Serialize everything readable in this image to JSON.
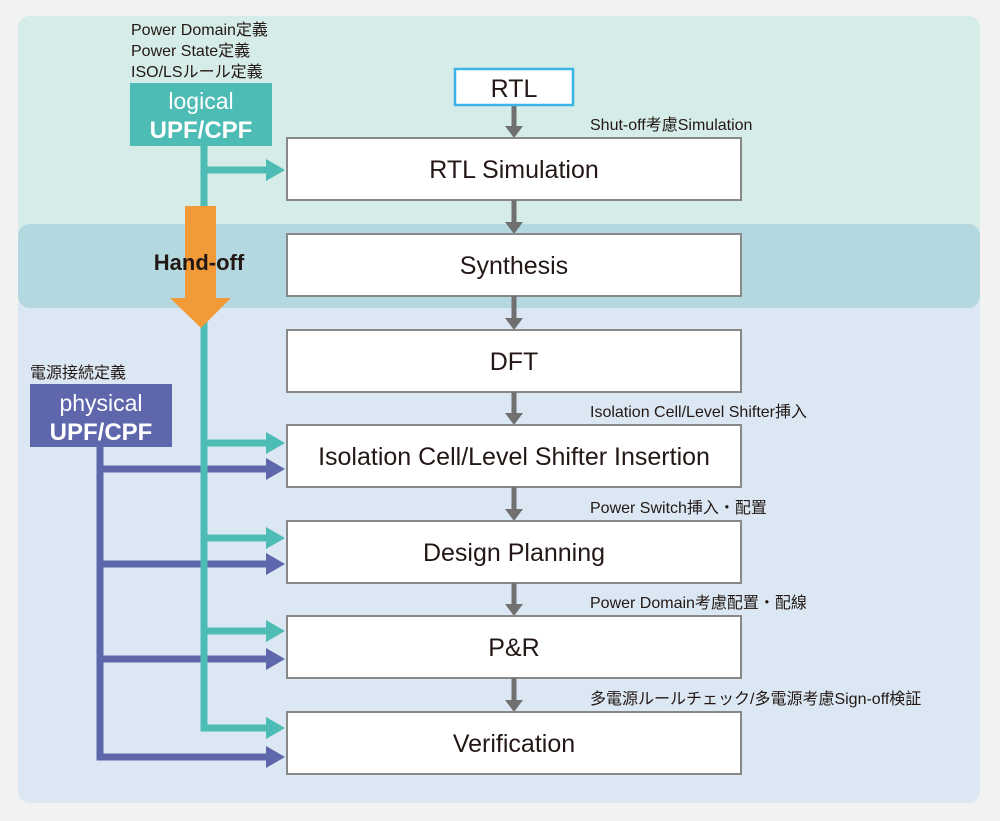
{
  "colors": {
    "background": "#f2f2f2",
    "logical_panel": "#d5ece8",
    "handoff_band": "#b3d8df",
    "physical_panel": "#dbe8f4",
    "logical": "#4dbcb4",
    "physical": "#5e66ac",
    "handoff_arrow": "#f39a38",
    "flow_arrow": "#707070",
    "rtl_border": "#3bb4e6"
  },
  "logical": {
    "notes": [
      "Power Domain定義",
      "Power State定義",
      "ISO/LSルール定義"
    ],
    "line1": "logical",
    "line2": "UPF/CPF"
  },
  "physical": {
    "note": "電源接続定義",
    "line1": "physical",
    "line2": "UPF/CPF"
  },
  "handoff": "Hand-off",
  "rtl": "RTL",
  "steps": [
    {
      "label": "RTL Simulation",
      "note": "Shut-off考慮Simulation"
    },
    {
      "label": "Synthesis",
      "note": ""
    },
    {
      "label": "DFT",
      "note": ""
    },
    {
      "label": "Isolation Cell/Level Shifter Insertion",
      "note": "Isolation Cell/Level Shifter挿入"
    },
    {
      "label": "Design Planning",
      "note": "Power Switch挿入・配置"
    },
    {
      "label": "P&R",
      "note": "Power Domain考慮配置・配線"
    },
    {
      "label": "Verification",
      "note": "多電源ルールチェック/多電源考慮Sign-off検証"
    }
  ]
}
